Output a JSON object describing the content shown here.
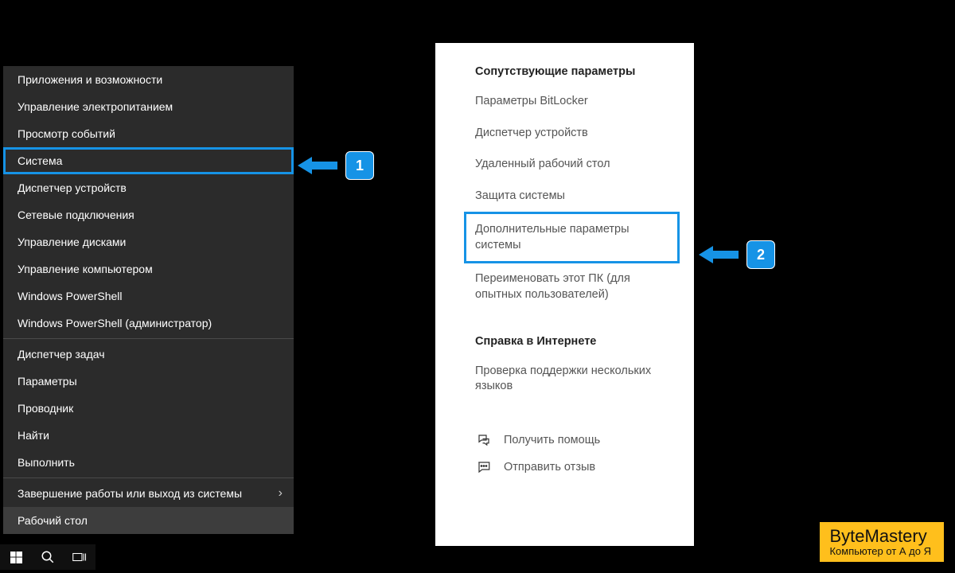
{
  "context_menu": {
    "items": [
      "Приложения и возможности",
      "Управление электропитанием",
      "Просмотр событий",
      "Система",
      "Диспетчер устройств",
      "Сетевые подключения",
      "Управление дисками",
      "Управление компьютером",
      "Windows PowerShell",
      "Windows PowerShell (администратор)",
      "Диспетчер задач",
      "Параметры",
      "Проводник",
      "Найти",
      "Выполнить",
      "Завершение работы или выход из системы",
      "Рабочий стол"
    ]
  },
  "settings": {
    "related_heading": "Сопутствующие параметры",
    "links": [
      "Параметры BitLocker",
      "Диспетчер устройств",
      "Удаленный рабочий стол",
      "Защита системы",
      "Дополнительные параметры системы",
      "Переименовать этот ПК (для опытных пользователей)"
    ],
    "help_heading": "Справка в Интернете",
    "help_link": "Проверка поддержки нескольких языков",
    "get_help": "Получить помощь",
    "feedback": "Отправить отзыв"
  },
  "callouts": {
    "one": "1",
    "two": "2"
  },
  "watermark": {
    "brand": "ByteMastery",
    "tag": "Компьютер от А до Я"
  }
}
